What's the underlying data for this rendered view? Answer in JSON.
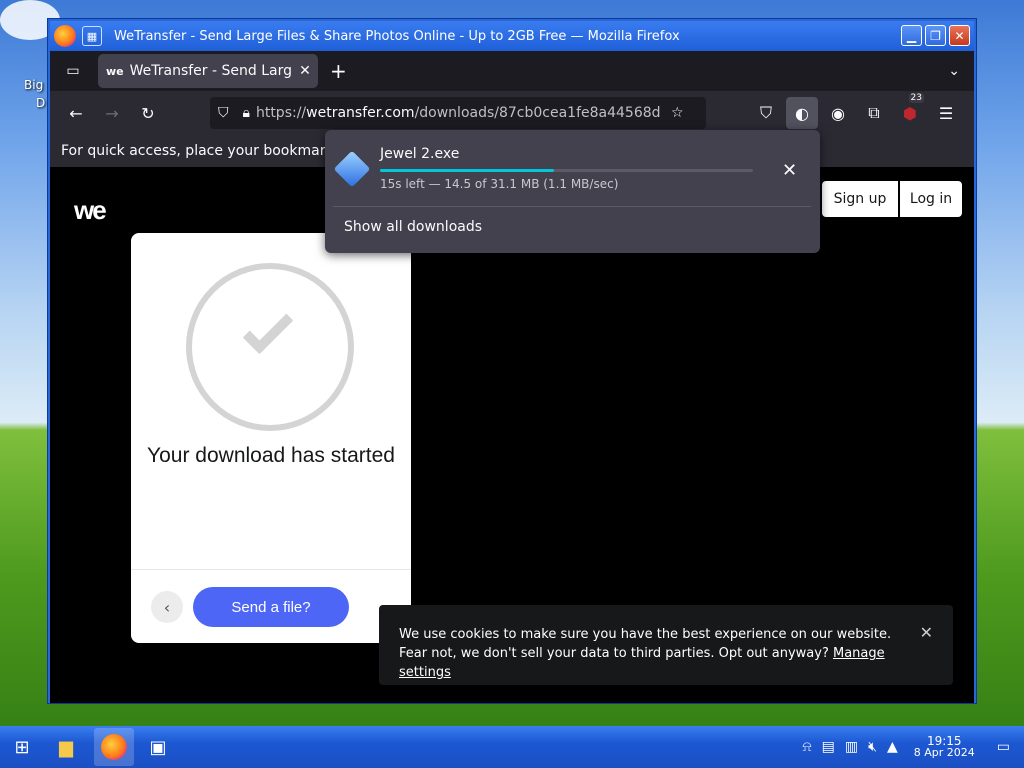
{
  "desktop": {
    "icon_label": "Big",
    "icon_label2": "D"
  },
  "window": {
    "title": "WeTransfer - Send Large Files & Share Photos Online - Up to 2GB Free — Mozilla Firefox"
  },
  "tab": {
    "title": "WeTransfer - Send Large Files & Share Photos Online",
    "favicon_text": "we"
  },
  "urlbar": {
    "url_prefix": "https://",
    "url_domain": "wetransfer.com",
    "url_path": "/downloads/87cb0cea1fe8a44568d"
  },
  "nav": {
    "extensions_badge": "23"
  },
  "bookmarks_bar": {
    "text": "For quick access, place your bookmarks"
  },
  "page": {
    "logo": "we",
    "signup_label": "Sign up",
    "login_label": "Log in",
    "card_title": "Your download has started",
    "send_label": "Send a file?"
  },
  "cookie": {
    "text": "We use cookies to make sure you have the best experience on our website. Fear not, we don't sell your data to third parties. Opt out anyway? ",
    "link": "Manage settings"
  },
  "downloads": {
    "file_name": "Jewel 2.exe",
    "status": "15s left — 14.5 of 31.1 MB (1.1 MB/sec)",
    "progress": 0.466,
    "show_all": "Show all downloads"
  },
  "taskbar": {
    "time": "19:15",
    "date": "8 Apr 2024"
  },
  "colors": {
    "accent": "#4e66f6",
    "progress": "#00c8d7",
    "titlebar": "#1f5fd8"
  }
}
